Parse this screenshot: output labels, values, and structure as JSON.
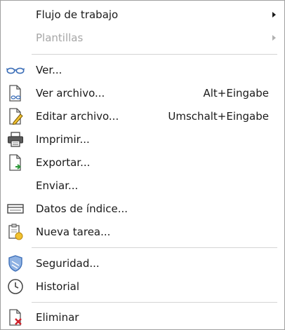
{
  "menu": {
    "items": [
      {
        "label": "Flujo de trabajo",
        "shortcut": "",
        "submenu": true,
        "disabled": false,
        "icon": "none"
      },
      {
        "label": "Plantillas",
        "shortcut": "",
        "submenu": true,
        "disabled": true,
        "icon": "none"
      },
      {
        "label": "Ver...",
        "shortcut": "",
        "submenu": false,
        "disabled": false,
        "icon": "glasses-icon"
      },
      {
        "label": "Ver archivo...",
        "shortcut": "Alt+Eingabe",
        "submenu": false,
        "disabled": false,
        "icon": "file-view-icon"
      },
      {
        "label": "Editar archivo...",
        "shortcut": "Umschalt+Eingabe",
        "submenu": false,
        "disabled": false,
        "icon": "file-edit-icon"
      },
      {
        "label": "Imprimir...",
        "shortcut": "",
        "submenu": false,
        "disabled": false,
        "icon": "printer-icon"
      },
      {
        "label": "Exportar...",
        "shortcut": "",
        "submenu": false,
        "disabled": false,
        "icon": "export-icon"
      },
      {
        "label": "Enviar...",
        "shortcut": "",
        "submenu": false,
        "disabled": false,
        "icon": "none"
      },
      {
        "label": "Datos de índice...",
        "shortcut": "",
        "submenu": false,
        "disabled": false,
        "icon": "index-data-icon"
      },
      {
        "label": "Nueva tarea...",
        "shortcut": "",
        "submenu": false,
        "disabled": false,
        "icon": "task-icon"
      },
      {
        "label": "Seguridad...",
        "shortcut": "",
        "submenu": false,
        "disabled": false,
        "icon": "shield-icon"
      },
      {
        "label": "Historial",
        "shortcut": "",
        "submenu": false,
        "disabled": false,
        "icon": "clock-icon"
      },
      {
        "label": "Eliminar",
        "shortcut": "",
        "submenu": false,
        "disabled": false,
        "icon": "delete-icon"
      }
    ]
  },
  "colors": {
    "accent_blue": "#3d6fb8",
    "delete_red": "#d0202a",
    "export_green": "#2e9a3a",
    "task_yellow": "#f2c230",
    "disabled_text": "#a6a6a6"
  }
}
